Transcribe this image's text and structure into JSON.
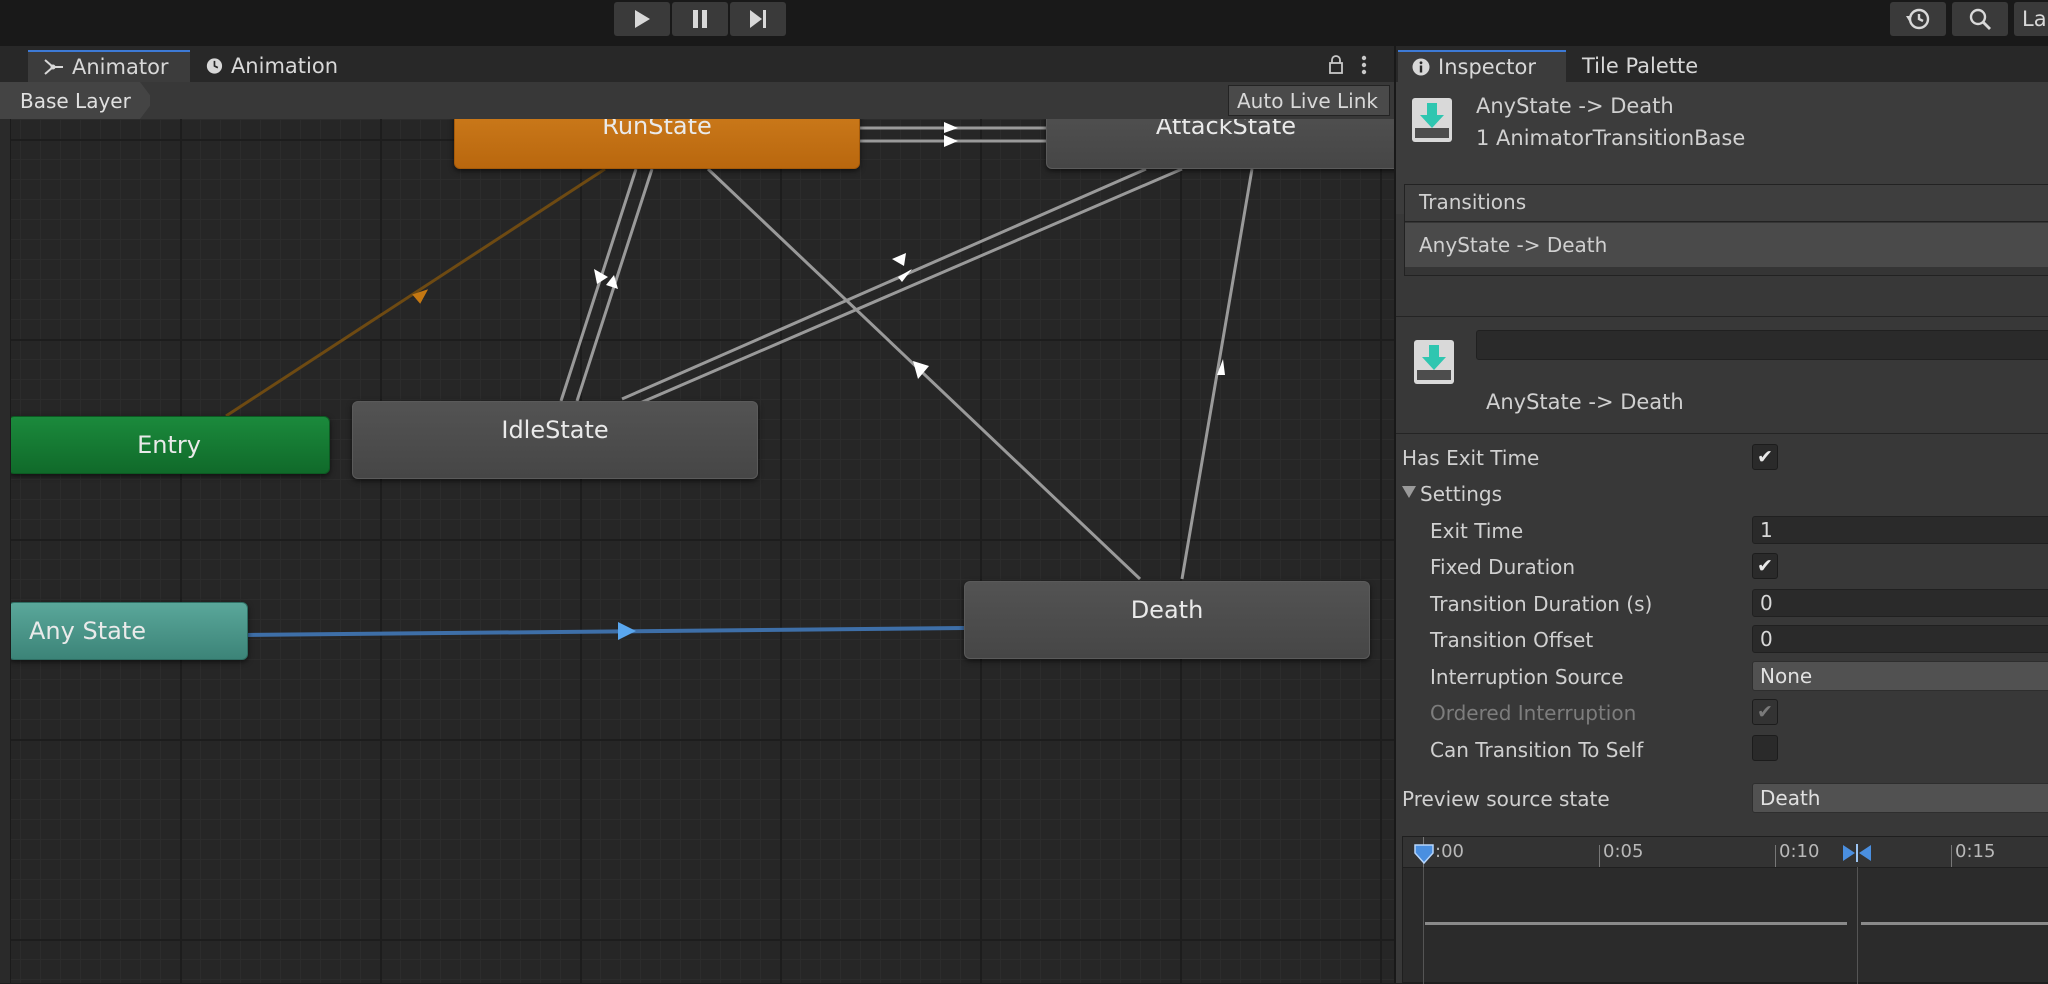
{
  "toolbar": {
    "play_icon": "play-icon",
    "pause_icon": "pause-icon",
    "step_icon": "step-icon",
    "history_icon": "history-icon",
    "search_icon": "search-icon",
    "layers_label": "La"
  },
  "animator": {
    "tabs": [
      {
        "label": "Animator",
        "icon": "animator-icon"
      },
      {
        "label": "Animation",
        "icon": "clock-icon"
      }
    ],
    "breadcrumb": "Base Layer",
    "auto_live_link": "Auto Live Link",
    "states": {
      "run": "RunState",
      "attack": "AttackState",
      "entry": "Entry",
      "idle": "IdleState",
      "any": "Any State",
      "death": "Death"
    },
    "colors": {
      "default_state": "#d1801f",
      "entry": "#1b8a3c",
      "any_state": "#5aa79a",
      "selected_transition": "#4a86d4"
    }
  },
  "inspector": {
    "tabs": [
      {
        "label": "Inspector",
        "icon": "info-icon"
      },
      {
        "label": "Tile Palette"
      }
    ],
    "header_title": "AnyState -> Death",
    "header_subtitle": "1 AnimatorTransitionBase",
    "transitions_header": "Transitions",
    "transitions_item": "AnyState -> Death",
    "transition_name_value": "",
    "transition_label": "AnyState -> Death",
    "has_exit_time_label": "Has Exit Time",
    "has_exit_time": true,
    "settings_label": "Settings",
    "exit_time_label": "Exit Time",
    "exit_time_value": "1",
    "fixed_duration_label": "Fixed Duration",
    "fixed_duration": true,
    "transition_duration_label": "Transition Duration (s)",
    "transition_duration_value": "0",
    "transition_offset_label": "Transition Offset",
    "transition_offset_value": "0",
    "interruption_source_label": "Interruption Source",
    "interruption_source_value": "None",
    "ordered_interruption_label": "Ordered Interruption",
    "ordered_interruption": true,
    "can_transition_to_self_label": "Can Transition To Self",
    "can_transition_to_self": false,
    "preview_source_label": "Preview source state",
    "preview_source_value": "Death",
    "timeline_ticks": [
      ":00",
      "0:05",
      "0:10",
      "0:15"
    ]
  }
}
